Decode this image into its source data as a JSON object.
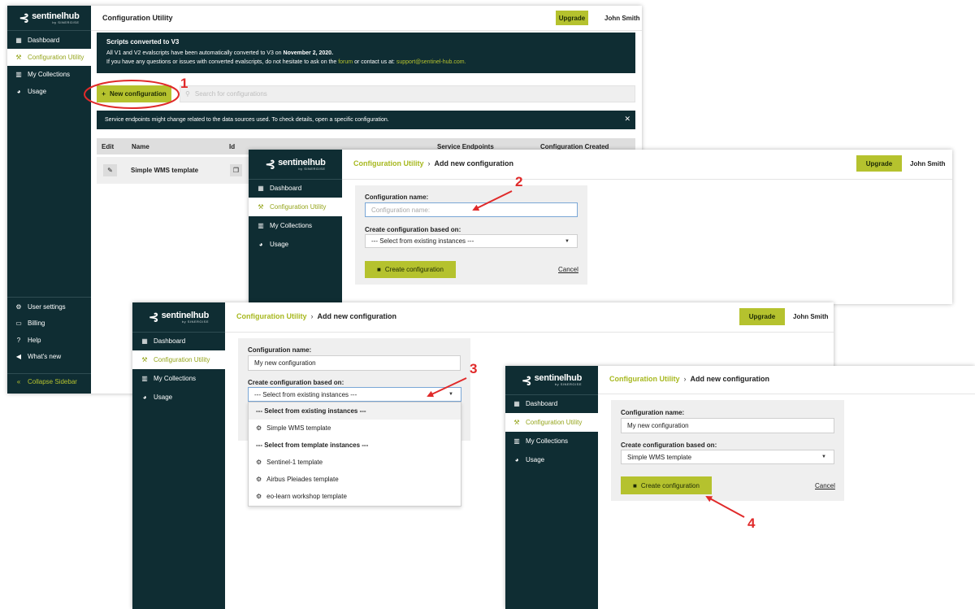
{
  "brand": {
    "mark": "⊰",
    "name": "sentinelhub",
    "sub": "by SINERGISE"
  },
  "colors": {
    "sidebar": "#0f2d33",
    "accent": "#b5c22e",
    "accent_text": "#95a51c",
    "annotation": "#e02a2a"
  },
  "nav": {
    "dashboard": "Dashboard",
    "configuration_utility": "Configuration Utility",
    "my_collections": "My Collections",
    "usage": "Usage",
    "user_settings": "User settings",
    "billing": "Billing",
    "help": "Help",
    "whats_new": "What's new",
    "collapse": "Collapse Sidebar"
  },
  "icons": {
    "dashboard": "grid-icon",
    "configuration_utility": "tools-icon",
    "my_collections": "map-icon",
    "usage": "pie-chart-icon",
    "user_settings": "gears-icon",
    "billing": "credit-card-icon",
    "help": "question-icon",
    "whats_new": "megaphone-icon",
    "collapse": "double-chevron-left-icon"
  },
  "header": {
    "upgrade": "Upgrade",
    "user": "John Smith"
  },
  "panel1": {
    "title": "Configuration Utility",
    "notice_title": "Scripts converted to V3",
    "notice_line1_a": "All V1 and V2 evalscripts have been automatically converted to V3 on ",
    "notice_line1_date": "November 2, 2020.",
    "notice_line2_a": "If you have any questions or issues with converted evalscripts, do not hesitate to ask on the ",
    "notice_forum": "forum",
    "notice_line2_b": " or contact us at: ",
    "notice_email": "support@sentinel-hub.com.",
    "new_config_button": "New configuration",
    "search_placeholder": "Search for configurations",
    "endpoint_banner": "Service endpoints might change related to the data sources used. To check details, open a specific configuration.",
    "table": {
      "headers": [
        "Edit",
        "Name",
        "Id",
        "Service Endpoints",
        "Configuration Created"
      ],
      "rows": [
        {
          "name": "Simple WMS template"
        }
      ]
    }
  },
  "form": {
    "breadcrumb_link": "Configuration Utility",
    "breadcrumb_sep": "›",
    "breadcrumb_current": "Add new configuration",
    "name_label": "Configuration name:",
    "name_placeholder": "Configuration name:",
    "name_value": "My new configuration",
    "based_on_label": "Create configuration based on:",
    "based_on_default": "--- Select from existing instances ---",
    "based_on_selected": "Simple WMS template",
    "create_button": "Create configuration",
    "cancel": "Cancel"
  },
  "dropdown": {
    "current": "--- Select from existing instances ---",
    "items": [
      {
        "type": "header",
        "label": "--- Select from existing instances ---"
      },
      {
        "type": "option",
        "label": "Simple WMS template"
      },
      {
        "type": "header",
        "label": "--- Select from template instances ---"
      },
      {
        "type": "option",
        "label": "Sentinel-1 template"
      },
      {
        "type": "option",
        "label": "Airbus Pleiades template"
      },
      {
        "type": "option",
        "label": "eo-learn workshop template"
      }
    ]
  },
  "annotations": {
    "step1": "1",
    "step2": "2",
    "step3": "3",
    "step4": "4"
  }
}
